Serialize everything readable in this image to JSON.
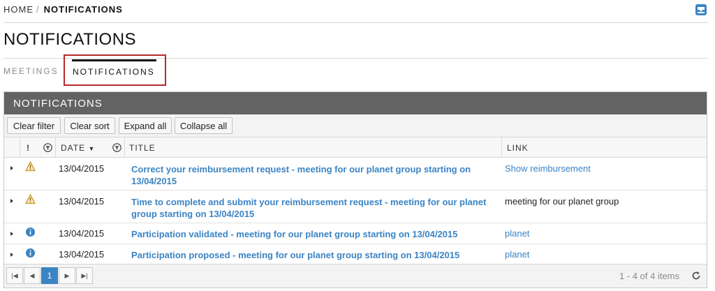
{
  "breadcrumb": {
    "home": "HOME",
    "separator": "/",
    "current": "NOTIFICATIONS"
  },
  "page": {
    "title": "NOTIFICATIONS"
  },
  "tabs": [
    {
      "label": "MEETINGS",
      "active": false
    },
    {
      "label": "NOTIFICATIONS",
      "active": true
    }
  ],
  "grid": {
    "header": "NOTIFICATIONS",
    "toolbar": {
      "clear_filter": "Clear filter",
      "clear_sort": "Clear sort",
      "expand_all": "Expand all",
      "collapse_all": "Collapse all"
    },
    "columns": {
      "priority": "!",
      "date": "DATE",
      "title": "TITLE",
      "link": "LINK"
    },
    "rows": [
      {
        "icon": "warning-icon",
        "date": "13/04/2015",
        "title": "Correct your reimbursement request - meeting for our planet group starting on 13/04/2015",
        "link": "Show reimbursement"
      },
      {
        "icon": "warning-icon",
        "date": "13/04/2015",
        "title": "Time to complete and submit your reimbursement request - meeting for our planet group starting on 13/04/2015",
        "link": "meeting for our planet group"
      },
      {
        "icon": "info-icon",
        "date": "13/04/2015",
        "title": "Participation validated - meeting for our planet group starting on 13/04/2015",
        "link": "planet"
      },
      {
        "icon": "info-icon",
        "date": "13/04/2015",
        "title": "Participation proposed - meeting for our planet group starting on 13/04/2015",
        "link": "planet"
      }
    ],
    "pager": {
      "current_page": "1",
      "info": "1 - 4 of 4 items"
    }
  },
  "colors": {
    "link": "#3b84c4",
    "header_bg": "#636363",
    "highlight_border": "#b32a2a",
    "warning": "#c8961e",
    "info": "#3b84c4"
  }
}
